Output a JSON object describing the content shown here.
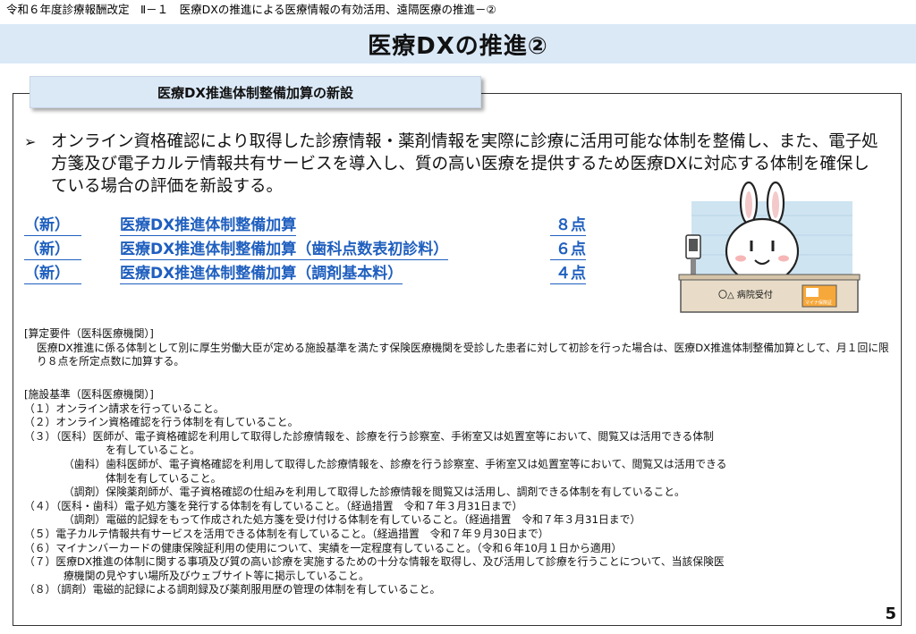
{
  "header": {
    "breadcrumb": "令和６年度診療報酬改定　Ⅱ－１　医療DXの推進による医療情報の有効活用、遠隔医療の推進－②"
  },
  "title": "医療DXの推進②",
  "section_tab": "医療DX推進体制整備加算の新設",
  "intro": "オンライン資格確認により取得した診療情報・薬剤情報を実際に診療に活用可能な体制を整備し、また、電子処方箋及び電子カルテ情報共有サービスを導入し、質の高い医療を提供するため医療DXに対応する体制を確保している場合の評価を新設する。",
  "items": [
    {
      "tag": "（新）",
      "name": "医療DX推進体制整備加算",
      "points": "８点"
    },
    {
      "tag": "（新）",
      "name": "医療DX推進体制整備加算（歯科点数表初診料）",
      "points": "６点"
    },
    {
      "tag": "（新）",
      "name": "医療DX推進体制整備加算（調剤基本料）",
      "points": "４点"
    }
  ],
  "illustration": {
    "desk_sign": "〇△ 病院受付",
    "card_label": "マイナ保険証"
  },
  "requirements": {
    "heading": "[算定要件（医科医療機関）]",
    "body": "医療DX推進に係る体制として別に厚生労働大臣が定める施設基準を満たす保険医療機関を受診した患者に対して初診を行った場合は、医療DX推進体制整備加算として、月１回に限り８点を所定点数に加算する。"
  },
  "standards": {
    "heading": "[施設基準（医科医療機関）]",
    "lines": [
      {
        "indent": 0,
        "text": "（１）オンライン請求を行っていること。"
      },
      {
        "indent": 0,
        "text": "（２）オンライン資格確認を行う体制を有していること。"
      },
      {
        "indent": 0,
        "text": "（３）（医科）医師が、電子資格確認を利用して取得した診療情報を、診療を行う診察室、手術室又は処置室等において、閲覧又は活用できる体制"
      },
      {
        "indent": 2,
        "text": "を有していること。"
      },
      {
        "indent": 1,
        "text": "（歯科）歯科医師が、電子資格確認を利用して取得した診療情報を、診療を行う診察室、手術室又は処置室等において、閲覧又は活用できる"
      },
      {
        "indent": 2,
        "text": "体制を有していること。"
      },
      {
        "indent": 1,
        "text": "（調剤）保険薬剤師が、電子資格確認の仕組みを利用して取得した診療情報を閲覧又は活用し、調剤できる体制を有していること。"
      },
      {
        "indent": 0,
        "text": "（４）（医科・歯科）電子処方箋を発行する体制を有していること。（経過措置　令和７年３月31日まで）"
      },
      {
        "indent": 1,
        "text": "（調剤）電磁的記録をもって作成された処方箋を受け付ける体制を有していること。（経過措置　令和７年３月31日まで）"
      },
      {
        "indent": 0,
        "text": "（５）電子カルテ情報共有サービスを活用できる体制を有していること。（経過措置　令和７年９月30日まで）"
      },
      {
        "indent": 0,
        "text": "（６）マイナンバーカードの健康保険証利用の使用について、実績を一定程度有していること。（令和６年10月１日から適用）"
      },
      {
        "indent": 0,
        "text": "（７）医療DX推進の体制に関する事項及び質の高い診療を実施するための十分な情報を取得し、及び活用して診療を行うことについて、当該保険医"
      },
      {
        "indent": 3,
        "text": "療機関の見やすい場所及びウェブサイト等に掲示していること。"
      },
      {
        "indent": 0,
        "text": "（８）（調剤）電磁的記録による調剤録及び薬剤服用歴の管理の体制を有していること。"
      }
    ]
  },
  "page_number": "5"
}
